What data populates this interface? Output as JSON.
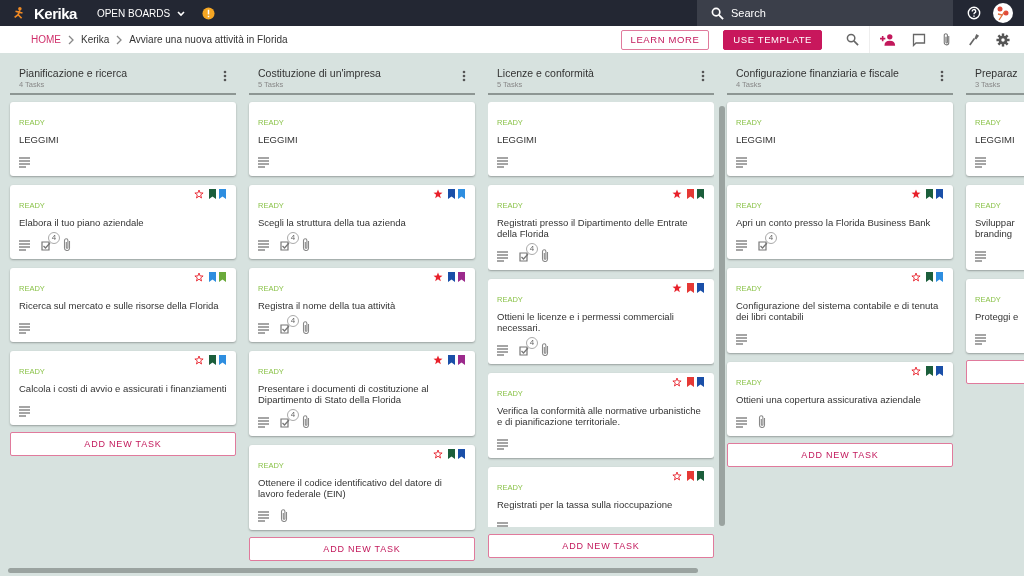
{
  "topbar": {
    "logo": "Kerika",
    "menu": "OPEN BOARDS",
    "search": {
      "placeholder": "Search"
    }
  },
  "toolbar": {
    "breadcrumbs": [
      {
        "label": "HOME",
        "kind": "link"
      },
      {
        "label": "Kerika",
        "kind": "text"
      },
      {
        "label": "Avviare una nuova attività in Florida",
        "kind": "text"
      }
    ],
    "buttons": [
      {
        "label": "LEARN MORE",
        "kind": "outline"
      },
      {
        "label": "USE TEMPLATE",
        "kind": "filled"
      }
    ]
  },
  "columns": [
    {
      "title": "Pianificazione e ricerca",
      "count": "4 Tasks",
      "add_label": "ADD NEW TASK",
      "cards": [
        {
          "status": "READY",
          "title": "LEGGIMI"
        },
        {
          "status": "READY",
          "title": "Elabora il tuo piano aziendale",
          "starred": false,
          "tags": [
            {
              "color": "#1b5e3b"
            },
            {
              "color": "#2e8ee0"
            }
          ],
          "checklist": "4",
          "attachment": true
        },
        {
          "status": "READY",
          "title": "Ricerca sul mercato e sulle risorse della Florida",
          "starred": false,
          "tags": [
            {
              "color": "#2e8ee0"
            },
            {
              "color": "#6aaa3a"
            }
          ]
        },
        {
          "status": "READY",
          "title": "Calcola i costi di avvio e assicurati i finanziamenti",
          "starred": false,
          "tags": [
            {
              "color": "#1b5e3b"
            },
            {
              "color": "#2e8ee0"
            }
          ]
        }
      ]
    },
    {
      "title": "Costituzione di un'impresa",
      "count": "5 Tasks",
      "add_label": "ADD NEW TASK",
      "cards": [
        {
          "status": "READY",
          "title": "LEGGIMI"
        },
        {
          "status": "READY",
          "title": "Scegli la struttura della tua azienda",
          "starred": true,
          "tags": [
            {
              "color": "#1a4fa8"
            },
            {
              "color": "#2e8ee0"
            }
          ],
          "checklist": "4",
          "attachment": true
        },
        {
          "status": "READY",
          "title": "Registra il nome della tua attività",
          "starred": true,
          "tags": [
            {
              "color": "#1a4fa8"
            },
            {
              "color": "#9c2a8c"
            }
          ],
          "checklist": "4",
          "attachment": true
        },
        {
          "status": "READY",
          "title": "Presentare i documenti di costituzione al Dipartimento di Stato della Florida",
          "starred": true,
          "tags": [
            {
              "color": "#1a4fa8"
            },
            {
              "color": "#9c2a8c"
            }
          ],
          "checklist": "4",
          "attachment": true
        },
        {
          "status": "READY",
          "title": "Ottenere il codice identificativo del datore di lavoro federale (EIN)",
          "starred": false,
          "tags": [
            {
              "color": "#1b5e3b"
            },
            {
              "color": "#1a4fa8"
            }
          ],
          "attachment": true
        }
      ]
    },
    {
      "title": "Licenze e conformità",
      "count": "5 Tasks",
      "add_label": "ADD NEW TASK",
      "scrollable": true,
      "cards": [
        {
          "status": "READY",
          "title": "LEGGIMI"
        },
        {
          "status": "READY",
          "title": "Registrati presso il Dipartimento delle Entrate della Florida",
          "starred": true,
          "tags": [
            {
              "color": "#e53935"
            },
            {
              "color": "#1b5e3b"
            }
          ],
          "checklist": "4",
          "attachment": true
        },
        {
          "status": "READY",
          "title": "Ottieni le licenze e i permessi commerciali necessari.",
          "starred": true,
          "tags": [
            {
              "color": "#e53935"
            },
            {
              "color": "#1a4fa8"
            }
          ],
          "checklist": "4",
          "attachment": true
        },
        {
          "status": "READY",
          "title": "Verifica la conformità alle normative urbanistiche e di pianificazione territoriale.",
          "starred": false,
          "tags": [
            {
              "color": "#e53935"
            },
            {
              "color": "#1a4fa8"
            }
          ]
        },
        {
          "status": "READY",
          "title": "Registrati per la tassa sulla rioccupazione",
          "starred": false,
          "tags": [
            {
              "color": "#e53935"
            },
            {
              "color": "#1b5e3b"
            }
          ]
        }
      ]
    },
    {
      "title": "Configurazione finanziaria e fiscale",
      "count": "4 Tasks",
      "add_label": "ADD NEW TASK",
      "cards": [
        {
          "status": "READY",
          "title": "LEGGIMI"
        },
        {
          "status": "READY",
          "title": "Apri un conto presso la Florida Business Bank",
          "starred": true,
          "tags": [
            {
              "color": "#1b5e3b"
            },
            {
              "color": "#1a4fa8"
            }
          ],
          "checklist": "4"
        },
        {
          "status": "READY",
          "title": "Configurazione del sistema contabile e di tenuta dei libri contabili",
          "starred": false,
          "tags": [
            {
              "color": "#1b5e3b"
            },
            {
              "color": "#2e8ee0"
            }
          ]
        },
        {
          "status": "READY",
          "title": "Ottieni una copertura assicurativa aziendale",
          "starred": false,
          "tags": [
            {
              "color": "#1b5e3b"
            },
            {
              "color": "#1a4fa8"
            }
          ],
          "attachment": true
        }
      ]
    },
    {
      "title": "Preparaz",
      "count": "3 Tasks",
      "cards": [
        {
          "status": "READY",
          "title": "LEGGIMI"
        },
        {
          "status": "READY",
          "title": "Sviluppar\nbranding"
        },
        {
          "status": "READY",
          "title": "Proteggi e"
        }
      ]
    }
  ]
}
